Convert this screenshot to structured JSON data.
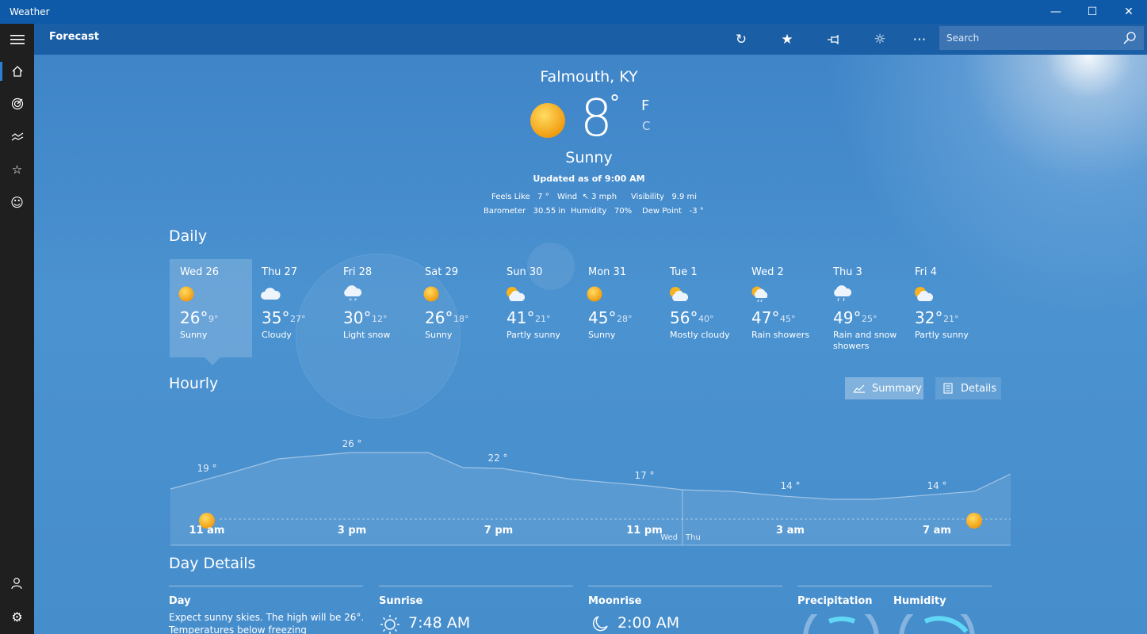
{
  "window": {
    "title": "Weather"
  },
  "appbar": {
    "page_title": "Forecast",
    "search_placeholder": "Search"
  },
  "current": {
    "location": "Falmouth, KY",
    "temperature": "8",
    "degree": "°",
    "unit_f": "F",
    "unit_c": "C",
    "condition": "Sunny",
    "updated": "Updated as of 9:00 AM",
    "feels_like_label": "Feels Like",
    "feels_like": "7 °",
    "wind_label": "Wind",
    "wind": "3 mph",
    "visibility_label": "Visibility",
    "visibility": "9.9 mi",
    "barometer_label": "Barometer",
    "barometer": "30.55 in",
    "humidity_label": "Humidity",
    "humidity": "70%",
    "dew_point_label": "Dew Point",
    "dew_point": "-3 °"
  },
  "daily": {
    "heading": "Daily",
    "days": [
      {
        "name": "Wed 26",
        "high": "26°",
        "low": "9°",
        "condition": "Sunny",
        "icon": "sun-icon"
      },
      {
        "name": "Thu 27",
        "high": "35°",
        "low": "27°",
        "condition": "Cloudy",
        "icon": "cloud-icon"
      },
      {
        "name": "Fri 28",
        "high": "30°",
        "low": "12°",
        "condition": "Light snow",
        "icon": "snow-icon"
      },
      {
        "name": "Sat 29",
        "high": "26°",
        "low": "18°",
        "condition": "Sunny",
        "icon": "sun-icon"
      },
      {
        "name": "Sun 30",
        "high": "41°",
        "low": "21°",
        "condition": "Partly sunny",
        "icon": "partly-sunny-icon"
      },
      {
        "name": "Mon 31",
        "high": "45°",
        "low": "28°",
        "condition": "Sunny",
        "icon": "sun-icon"
      },
      {
        "name": "Tue 1",
        "high": "56°",
        "low": "40°",
        "condition": "Mostly cloudy",
        "icon": "partly-sunny-icon"
      },
      {
        "name": "Wed 2",
        "high": "47°",
        "low": "45°",
        "condition": "Rain showers",
        "icon": "rain-sun-icon"
      },
      {
        "name": "Thu 3",
        "high": "49°",
        "low": "25°",
        "condition": "Rain and snow showers",
        "icon": "rain-snow-icon"
      },
      {
        "name": "Fri 4",
        "high": "32°",
        "low": "21°",
        "condition": "Partly sunny",
        "icon": "partly-sunny-icon"
      }
    ]
  },
  "hourly": {
    "heading": "Hourly",
    "summary_label": "Summary",
    "details_label": "Details",
    "temp_labels": [
      "19 °",
      "26 °",
      "22 °",
      "17 °",
      "14 °",
      "14 °"
    ],
    "time_labels": [
      "11 am",
      "3 pm",
      "7 pm",
      "11 pm",
      "3 am",
      "7 am"
    ],
    "day_split": [
      "Wed",
      "Thu"
    ]
  },
  "day_details": {
    "heading": "Day Details",
    "day_label": "Day",
    "day_text_1": "Expect sunny skies. The high will be 26°.",
    "day_text_2": "Temperatures below freezing",
    "sunrise_label": "Sunrise",
    "sunrise": "7:48 AM",
    "moonrise_label": "Moonrise",
    "moonrise": "2:00 AM",
    "precip_label": "Precipitation",
    "humidity_label": "Humidity"
  },
  "colors": {
    "accent": "#2d7fd6",
    "sun": "#f7b21e",
    "gauge": "#5fd7f5"
  }
}
